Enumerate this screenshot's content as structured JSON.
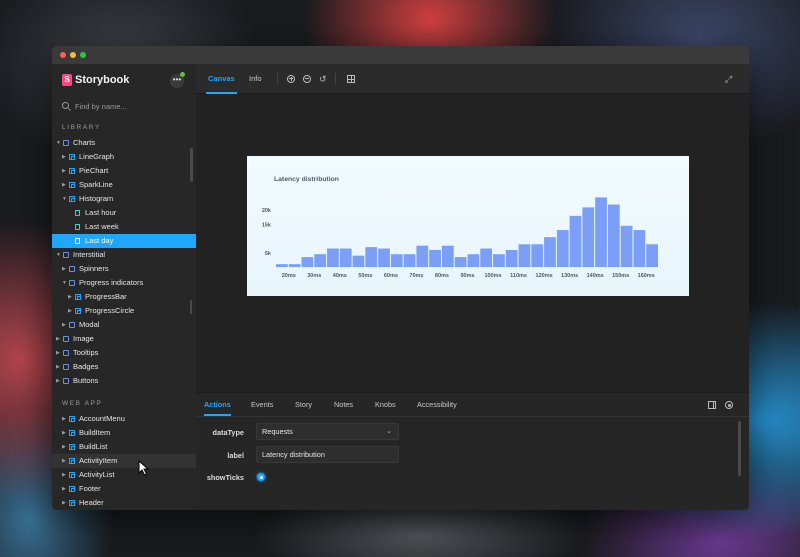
{
  "app": {
    "title": "Storybook",
    "logo_letter": "S"
  },
  "search": {
    "placeholder": "Find by name..."
  },
  "sidebar": {
    "library_label": "LIBRARY",
    "library_items": [
      {
        "label": "Charts",
        "type": "folder",
        "level": 0,
        "expanded": true
      },
      {
        "label": "LineGraph",
        "type": "component",
        "level": 1
      },
      {
        "label": "PieChart",
        "type": "component",
        "level": 1
      },
      {
        "label": "SparkLine",
        "type": "component",
        "level": 1
      },
      {
        "label": "Histogram",
        "type": "component",
        "level": 1,
        "expanded": true
      },
      {
        "label": "Last hour",
        "type": "story",
        "level": 2
      },
      {
        "label": "Last week",
        "type": "story",
        "level": 2
      },
      {
        "label": "Last day",
        "type": "story",
        "level": 2,
        "selected": true
      },
      {
        "label": "Interstitial",
        "type": "folder",
        "level": 0,
        "expanded": true
      },
      {
        "label": "Spinners",
        "type": "folder",
        "level": 1
      },
      {
        "label": "Progress indicators",
        "type": "folder",
        "level": 1,
        "expanded": true
      },
      {
        "label": "ProgressBar",
        "type": "component",
        "level": 2
      },
      {
        "label": "ProgressCircle",
        "type": "component",
        "level": 2
      },
      {
        "label": "Modal",
        "type": "folder",
        "level": 1
      },
      {
        "label": "Image",
        "type": "folder",
        "level": 0
      },
      {
        "label": "Tooltips",
        "type": "folder",
        "level": 0
      },
      {
        "label": "Badges",
        "type": "folder",
        "level": 0
      },
      {
        "label": "Buttons",
        "type": "folder",
        "level": 0
      }
    ],
    "webapp_label": "WEB APP",
    "webapp_items": [
      {
        "label": "AccountMenu",
        "type": "component"
      },
      {
        "label": "BuildItem",
        "type": "component"
      },
      {
        "label": "BuildList",
        "type": "component"
      },
      {
        "label": "ActivityItem",
        "type": "component",
        "hovered": true
      },
      {
        "label": "ActivityList",
        "type": "component"
      },
      {
        "label": "Footer",
        "type": "component"
      },
      {
        "label": "Header",
        "type": "component"
      }
    ]
  },
  "toolbar": {
    "tabs": [
      "Canvas",
      "Info"
    ],
    "active_tab": "Canvas",
    "icons": [
      "zoom-in-icon",
      "zoom-out-icon",
      "zoom-reset-icon",
      "grid-icon",
      "fullscreen-icon"
    ]
  },
  "panel": {
    "tabs": [
      "Actions",
      "Events",
      "Story",
      "Notes",
      "Knobs",
      "Accessibility"
    ],
    "active_tab": "Actions",
    "knobs": {
      "dataType_label": "dataType",
      "dataType_value": "Requests",
      "label_label": "label",
      "label_value": "Latency distribution",
      "showTicks_label": "showTicks",
      "showTicks_value": true
    }
  },
  "colors": {
    "accent": "#1ea7fd",
    "storybook_pink": "#ff4785",
    "bar": "#7b9ef6",
    "bar_highlight": "#5b82f2"
  },
  "chart_data": {
    "type": "bar",
    "title": "Latency distribution",
    "xlabel": "",
    "ylabel": "",
    "x_tick_labels": [
      "20ms",
      "30ms",
      "40ms",
      "50ms",
      "60ms",
      "70ms",
      "80ms",
      "90ms",
      "100ms",
      "110ms",
      "120ms",
      "130ms",
      "140ms",
      "150ms",
      "160ms"
    ],
    "y_tick_labels": [
      "5k",
      "15k",
      "20k"
    ],
    "ylim": [
      0,
      25000
    ],
    "values": [
      1000,
      1000,
      3500,
      4500,
      6500,
      6500,
      4000,
      7000,
      6500,
      4500,
      4500,
      7500,
      6000,
      7500,
      3500,
      4500,
      6500,
      4500,
      6000,
      8000,
      8000,
      10500,
      13000,
      18000,
      21000,
      24500,
      22000,
      14500,
      13000,
      8000
    ],
    "grid": false
  }
}
